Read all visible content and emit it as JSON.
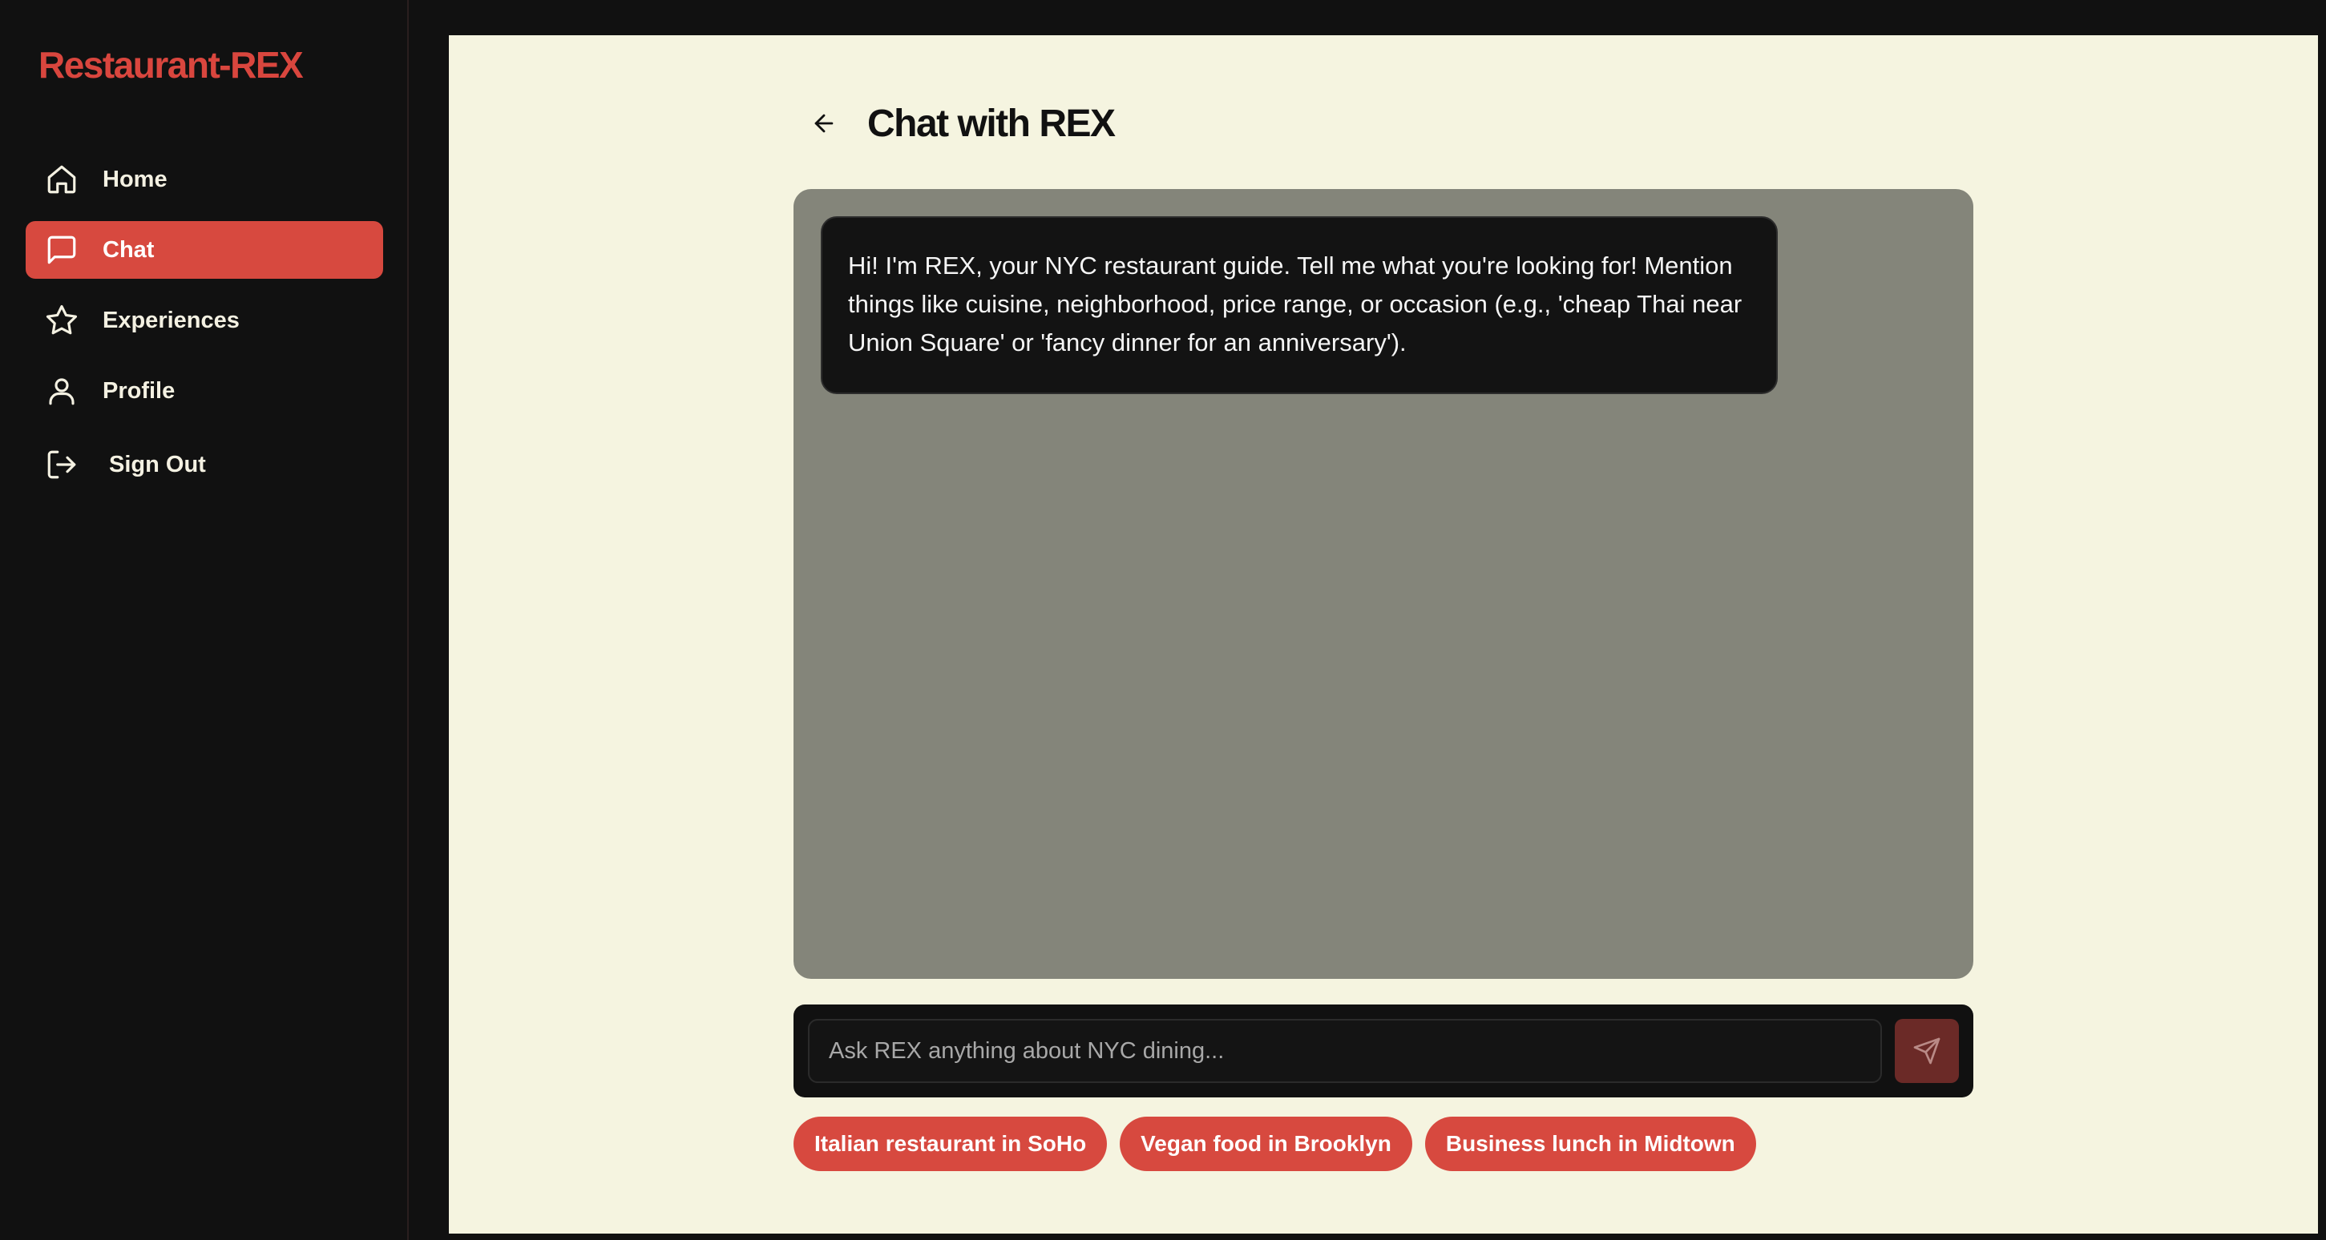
{
  "app": {
    "brand": "Restaurant-REX"
  },
  "colors": {
    "accent": "#d7493f",
    "sidebar_bg": "#111111",
    "main_bg": "#f5f4e0",
    "chat_area_bg": "#84857a"
  },
  "sidebar": {
    "items": [
      {
        "label": "Home",
        "icon": "home-icon",
        "active": false
      },
      {
        "label": "Chat",
        "icon": "message-square-icon",
        "active": true
      },
      {
        "label": "Experiences",
        "icon": "star-icon",
        "active": false
      },
      {
        "label": "Profile",
        "icon": "user-icon",
        "active": false
      }
    ],
    "sign_out": {
      "label": "Sign Out",
      "icon": "log-out-icon"
    }
  },
  "header": {
    "back_icon": "arrow-left-icon",
    "title": "Chat with REX"
  },
  "chat": {
    "messages": [
      {
        "sender": "REX",
        "text": "Hi! I'm REX, your NYC restaurant guide. Tell me what you're looking for! Mention things like cuisine, neighborhood, price range, or occasion (e.g., 'cheap Thai near Union Square' or 'fancy dinner for an anniversary')."
      }
    ]
  },
  "input": {
    "value": "",
    "placeholder": "Ask REX anything about NYC dining...",
    "send_icon": "send-icon"
  },
  "suggestions": [
    "Italian restaurant in SoHo",
    "Vegan food in Brooklyn",
    "Business lunch in Midtown"
  ]
}
